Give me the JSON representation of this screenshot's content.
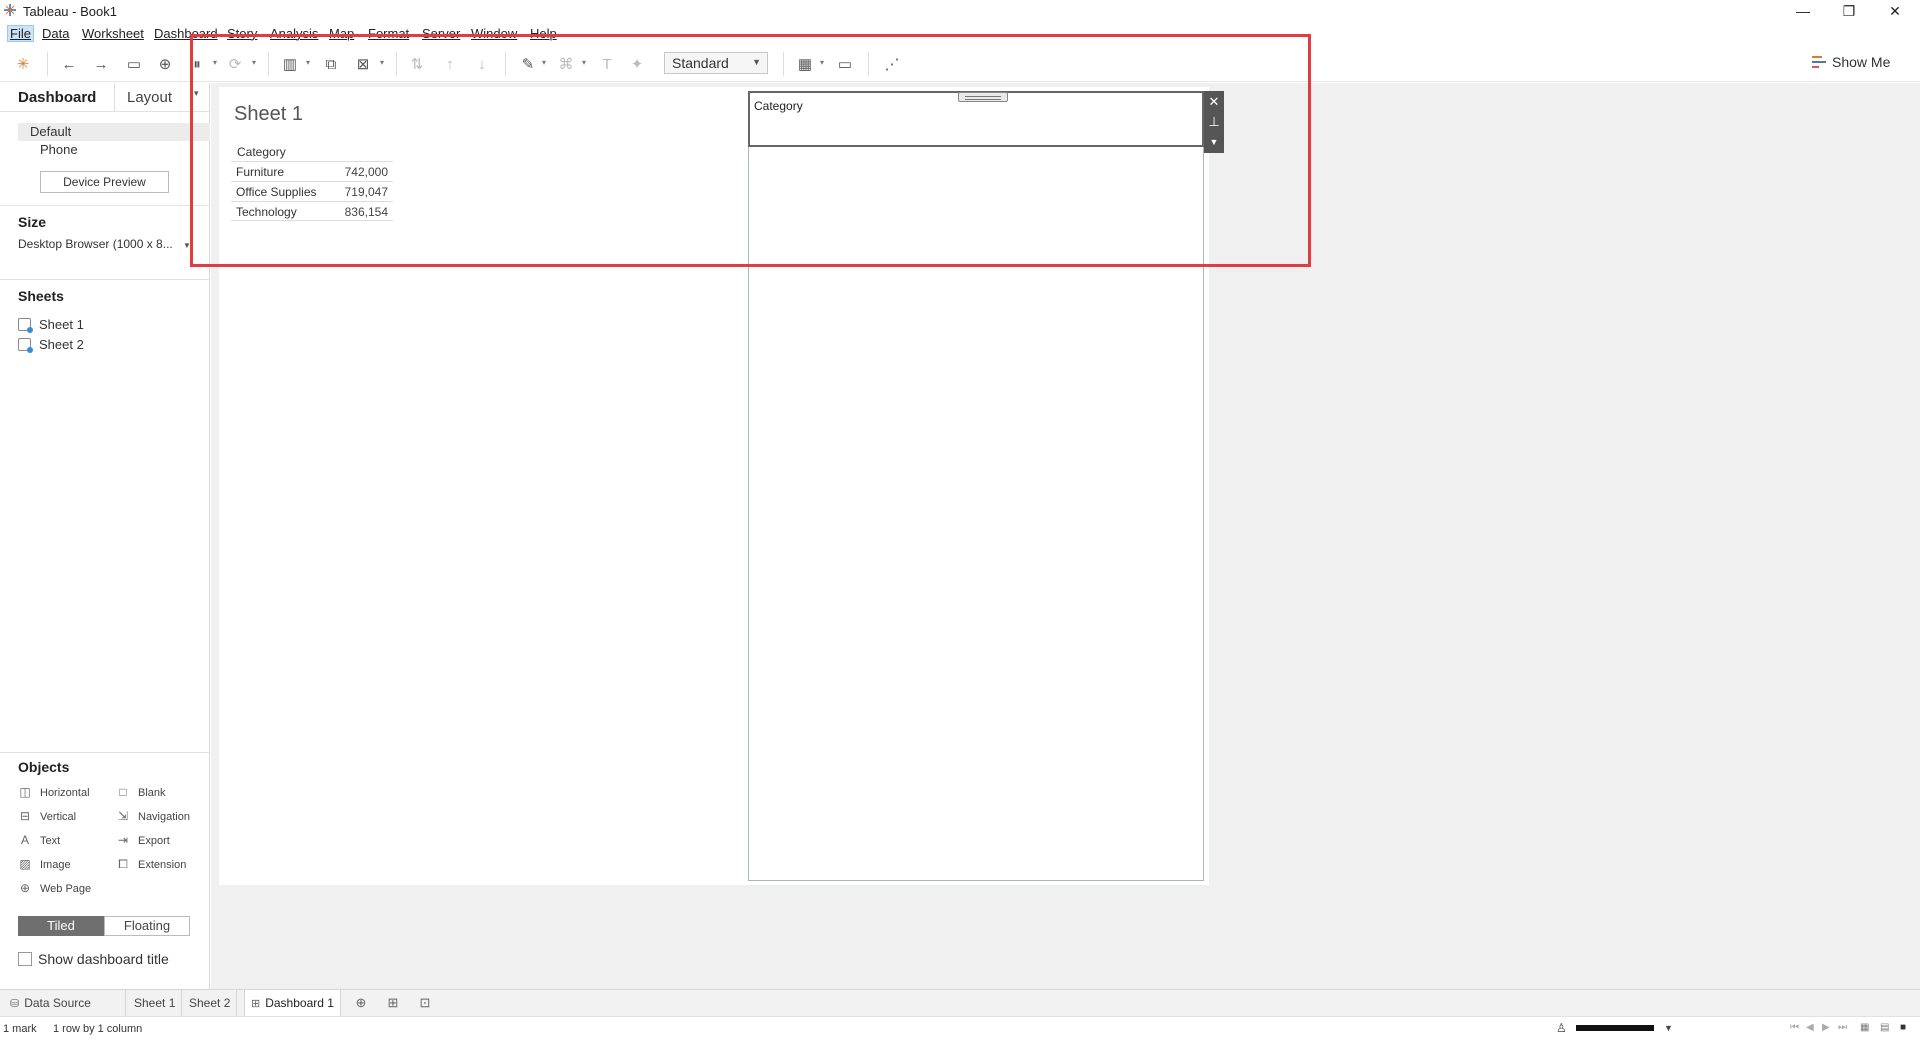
{
  "window": {
    "title": "Tableau - Book1",
    "minimize": "—",
    "restore": "❐",
    "close": "✕"
  },
  "menu": [
    {
      "label": "File"
    },
    {
      "label": "Data"
    },
    {
      "label": "Worksheet"
    },
    {
      "label": "Dashboard"
    },
    {
      "label": "Story"
    },
    {
      "label": "Analysis"
    },
    {
      "label": "Map"
    },
    {
      "label": "Format"
    },
    {
      "label": "Server"
    },
    {
      "label": "Window"
    },
    {
      "label": "Help"
    }
  ],
  "toolbar": {
    "fit_value": "Standard",
    "show_me_label": "Show Me"
  },
  "left_pane": {
    "tab_dashboard": "Dashboard",
    "tab_layout": "Layout",
    "device_default": "Default",
    "device_phone": "Phone",
    "device_preview": "Device Preview",
    "size_heading": "Size",
    "size_value": "Desktop Browser (1000 x 8...",
    "sheets_heading": "Sheets",
    "sheets": [
      "Sheet 1",
      "Sheet 2"
    ],
    "objects_heading": "Objects",
    "objects": {
      "horizontal": "Horizontal",
      "vertical": "Vertical",
      "text": "Text",
      "image": "Image",
      "web_page": "Web Page",
      "blank": "Blank",
      "navigation": "Navigation",
      "export": "Export",
      "extension": "Extension"
    },
    "tiled": "Tiled",
    "floating": "Floating",
    "show_dashboard_title": "Show dashboard title"
  },
  "dashboard": {
    "sheet1_title": "Sheet 1",
    "column_header": "Category",
    "rows": [
      {
        "name": "Furniture",
        "value": "742,000"
      },
      {
        "name": "Office Supplies",
        "value": "719,047"
      },
      {
        "name": "Technology",
        "value": "836,154"
      }
    ],
    "filter_title": "Category"
  },
  "bottom_tabs": {
    "data_source": "Data Source",
    "sheet1": "Sheet 1",
    "sheet2": "Sheet 2",
    "dashboard1": "Dashboard 1"
  },
  "status": {
    "marks": "1 mark",
    "rows_cols": "1 row by 1 column"
  }
}
